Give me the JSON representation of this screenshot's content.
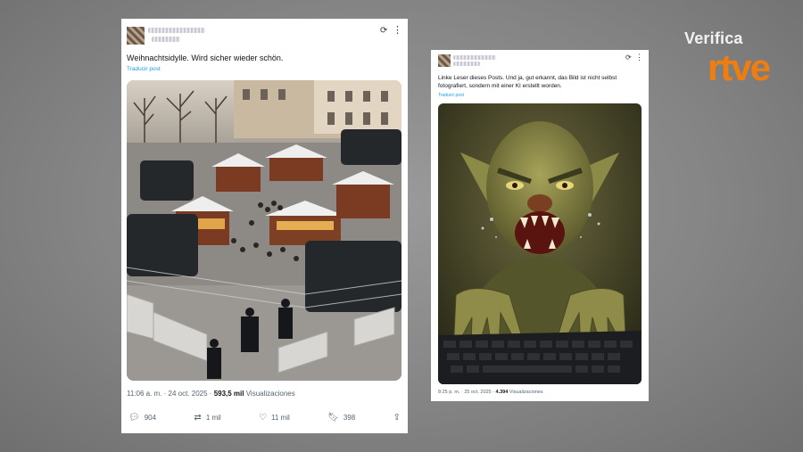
{
  "brand": {
    "verifica": "Verifica",
    "rtve": "rtve"
  },
  "post1": {
    "text": "Weihnachtsidylle. Wird sicher wieder schön.",
    "translate": "Traducir post",
    "time": "11:06 a. m. · 24 oct. 2025 · ",
    "views": "593,5 mil",
    "views_label": " Visualizaciones",
    "replies": "904",
    "reposts": "1 mil",
    "likes": "11 mil",
    "bookmarks": "398",
    "image_icon": "christmas-market-photo"
  },
  "post2": {
    "text": "Linke Leser dieses Posts. Und ja, gut erkannt, das Bild ist nicht selbst fotografiert, sondern mit einer KI erstellt worden.",
    "translate": "Traducir post",
    "time": "8:25 p. m. · 25 oct. 2025 · ",
    "views": "4.394",
    "views_label": " Visualizaciones",
    "image_icon": "troll-keyboard-illustration"
  },
  "colors": {
    "link": "#1d9bf0",
    "brand": "#f07d0f"
  }
}
